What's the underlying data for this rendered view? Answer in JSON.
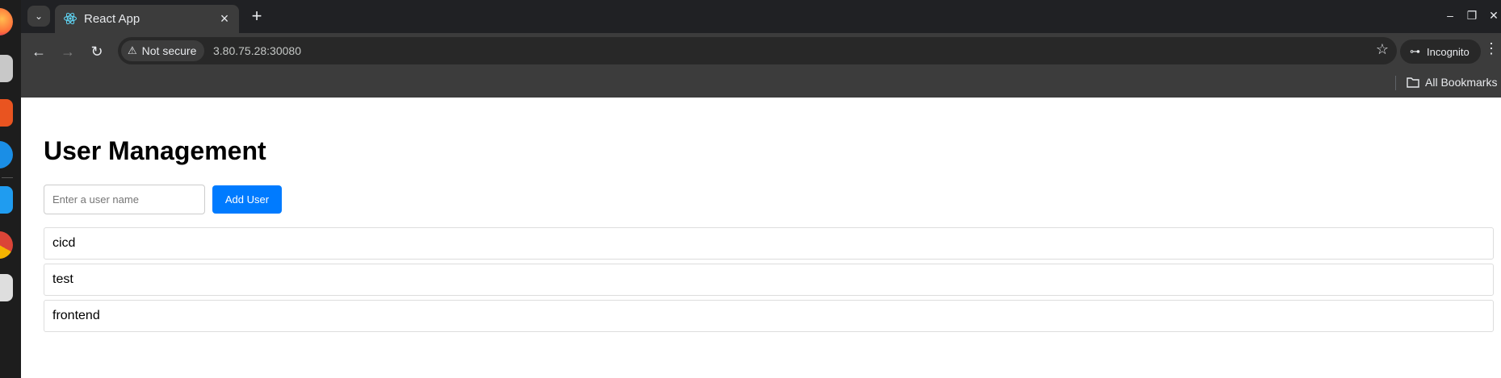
{
  "browser": {
    "tab": {
      "title": "React App",
      "close_icon": "×",
      "favicon": "react-logo"
    },
    "new_tab_icon": "+",
    "window_controls": {
      "minimize": "–",
      "restore": "❐",
      "close": "✕"
    },
    "toolbar": {
      "security_label": "Not secure",
      "url": "3.80.75.28:30080"
    },
    "incognito_label": "Incognito",
    "bookmarks": {
      "all_bookmarks_label": "All Bookmarks"
    }
  },
  "page": {
    "title": "User Management",
    "form": {
      "input_value": "",
      "input_placeholder": "Enter a user name",
      "add_button_label": "Add User",
      "button_color": "#007bff"
    },
    "users": [
      "cicd",
      "test",
      "frontend"
    ]
  },
  "colors": {
    "accent": "#007bff",
    "chrome_dark": "#202124",
    "toolbar": "#3c3c3c"
  }
}
